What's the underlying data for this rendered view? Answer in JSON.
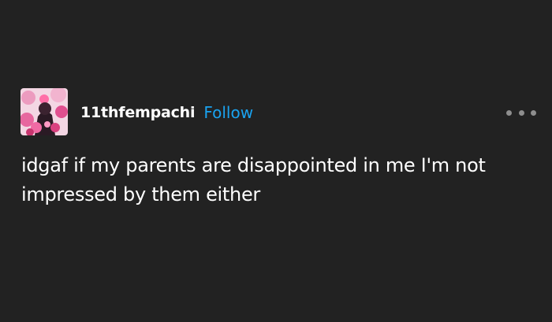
{
  "post": {
    "author": "11thfempachi",
    "follow_label": "Follow",
    "text": "idgaf if my parents are disappointed in me I'm not impressed by them either"
  },
  "icons": {
    "avatar": "user-avatar",
    "more": "more-options-icon"
  },
  "colors": {
    "background": "#222222",
    "text": "#ffffff",
    "follow": "#1aa3f0",
    "more_dots": "#8e8e8e"
  }
}
